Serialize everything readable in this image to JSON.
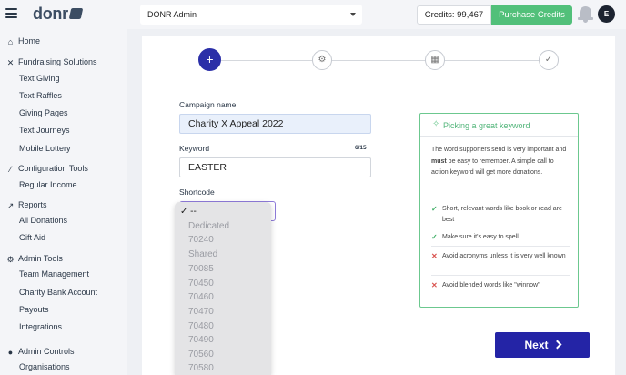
{
  "topbar": {
    "logo_text": "donr",
    "org_selected": "DONR Admin",
    "credits_label": "Credits: 99,467",
    "purchase_label": "Purchase Credits",
    "avatar_initial": "E"
  },
  "sidebar": {
    "sections": [
      {
        "label": "Home",
        "icon": "home-icon",
        "items": []
      },
      {
        "label": "Fundraising Solutions",
        "icon": "tools-icon",
        "items": [
          "Text Giving",
          "Text Raffles",
          "Giving Pages",
          "Text Journeys",
          "Mobile Lottery"
        ]
      },
      {
        "label": "Configuration Tools",
        "icon": "wand-icon",
        "items": [
          "Regular Income"
        ]
      },
      {
        "label": "Reports",
        "icon": "chart-icon",
        "items": [
          "All Donations",
          "Gift Aid"
        ]
      },
      {
        "label": "Admin Tools",
        "icon": "gears-icon",
        "items": [
          "Team Management",
          "Charity Bank Account",
          "Payouts",
          "Integrations"
        ]
      },
      {
        "label": "Admin Controls",
        "icon": "users-icon",
        "items": [
          "Organisations"
        ]
      }
    ]
  },
  "form": {
    "campaign_label": "Campaign name",
    "campaign_value": "Charity X Appeal 2022",
    "keyword_label": "Keyword",
    "keyword_counter": "6/15",
    "keyword_value": "EASTER",
    "shortcode_label": "Shortcode",
    "next_label": "Next"
  },
  "tips": {
    "title": "Picking a great keyword",
    "intro_1": "The word supporters send is very important and ",
    "intro_bold": "must",
    "intro_2": " be easy to remember. A simple call to action keyword will get more donations.",
    "items": [
      {
        "type": "ok",
        "text": "Short, relevant words like book or read are best"
      },
      {
        "type": "ok",
        "text": "Make sure it's easy to spell"
      },
      {
        "type": "bad",
        "text": "Avoid acronyms unless it is very well known"
      },
      {
        "type": "bad",
        "text": "Avoid blended words like \"winnow\""
      }
    ]
  },
  "dropdown": {
    "options": [
      "✓ --",
      "Dedicated",
      "70240",
      "Shared",
      "70085",
      "70450",
      "70460",
      "70470",
      "70480",
      "70490",
      "70560",
      "70580"
    ]
  },
  "colors": {
    "accent": "#2424a6",
    "success": "#52c07a",
    "tips_border": "#6cc88f"
  }
}
